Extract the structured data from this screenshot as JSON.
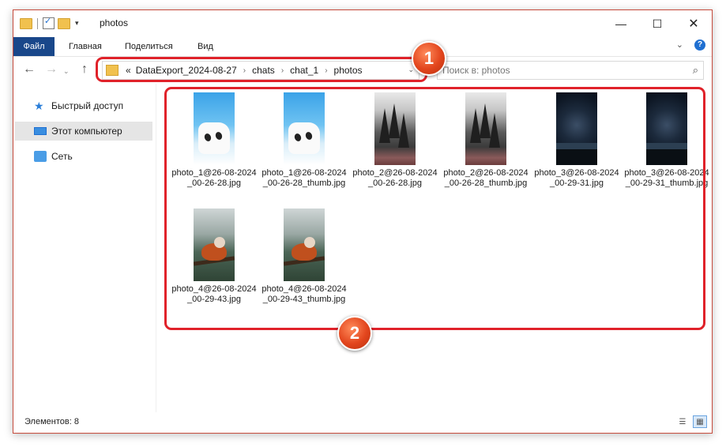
{
  "window": {
    "title": "photos",
    "controls": {
      "minimize": "—",
      "maximize": "☐",
      "close": "✕"
    }
  },
  "ribbon": {
    "file_tab": "Файл",
    "tabs": [
      "Главная",
      "Поделиться",
      "Вид"
    ],
    "collapse_glyph": "⌄",
    "help_glyph": "?"
  },
  "navigation": {
    "back_glyph": "←",
    "forward_glyph": "→",
    "history_glyph": "⌄",
    "up_glyph": "↑",
    "path_prefix": "«",
    "breadcrumb": [
      "DataExport_2024-08-27",
      "chats",
      "chat_1",
      "photos"
    ],
    "crumb_separator": "›",
    "dropdown_glyph": "⌄",
    "refresh_glyph": "↻",
    "search_placeholder": "Поиск в: photos"
  },
  "sidebar": {
    "items": [
      {
        "label": "Быстрый доступ",
        "icon": "star-icon"
      },
      {
        "label": "Этот компьютер",
        "icon": "computer-icon",
        "selected": true
      },
      {
        "label": "Сеть",
        "icon": "network-icon"
      }
    ]
  },
  "files": [
    {
      "name": "photo_1@26-08-2024_00-26-28.jpg",
      "thumb": "marshmello"
    },
    {
      "name": "photo_1@26-08-2024_00-26-28_thumb.jpg",
      "thumb": "marshmello"
    },
    {
      "name": "photo_2@26-08-2024_00-26-28.jpg",
      "thumb": "forest"
    },
    {
      "name": "photo_2@26-08-2024_00-26-28_thumb.jpg",
      "thumb": "forest"
    },
    {
      "name": "photo_3@26-08-2024_00-29-31.jpg",
      "thumb": "night-sky"
    },
    {
      "name": "photo_3@26-08-2024_00-29-31_thumb.jpg",
      "thumb": "night-sky"
    },
    {
      "name": "photo_4@26-08-2024_00-29-43.jpg",
      "thumb": "red-panda"
    },
    {
      "name": "photo_4@26-08-2024_00-29-43_thumb.jpg",
      "thumb": "red-panda"
    }
  ],
  "annotations": [
    {
      "number": "1"
    },
    {
      "number": "2"
    }
  ],
  "status": {
    "item_count": "Элементов: 8"
  },
  "colors": {
    "file_tab_bg": "#19478a",
    "annotation_red": "#e0222a",
    "badge_orange": "#e2451d",
    "selection_gray": "#e5e5e5"
  }
}
